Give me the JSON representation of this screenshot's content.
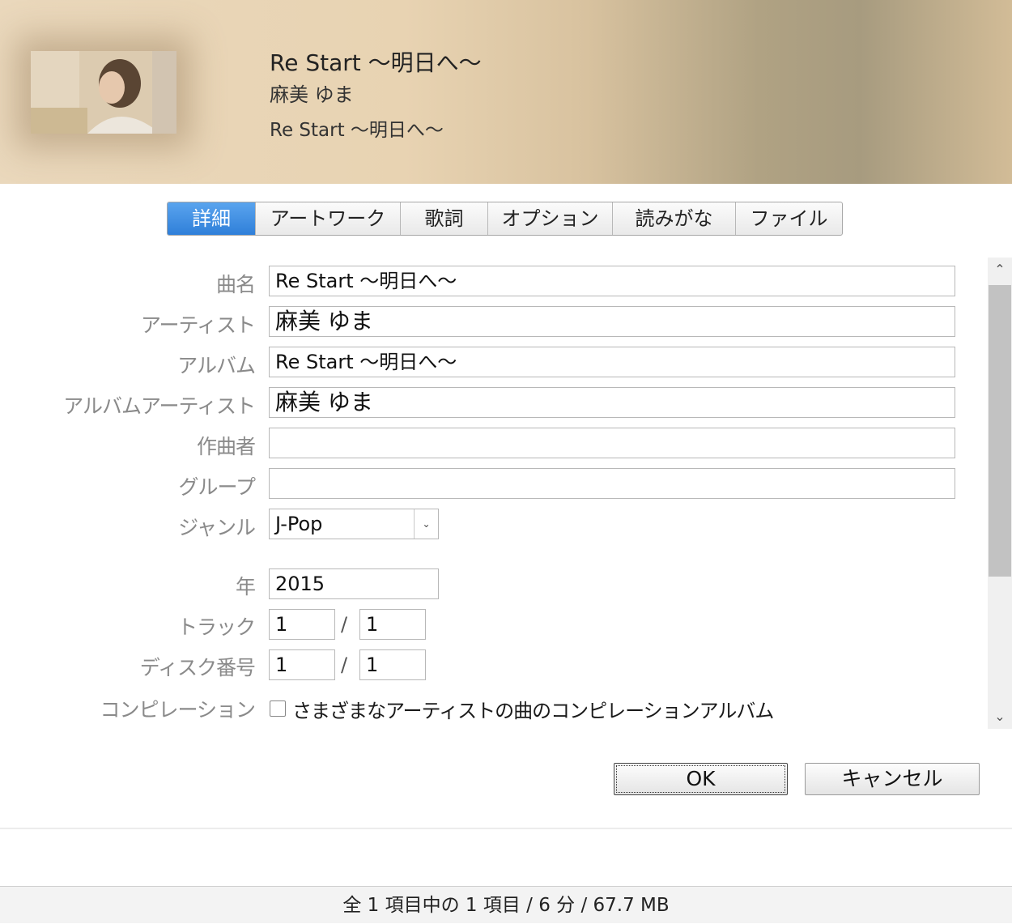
{
  "header": {
    "title": "Re Start 〜明日へ〜",
    "artist": "麻美 ゆま",
    "album": "Re Start 〜明日へ〜"
  },
  "tabs": [
    {
      "label": "詳細",
      "active": true
    },
    {
      "label": "アートワーク",
      "active": false
    },
    {
      "label": "歌詞",
      "active": false
    },
    {
      "label": "オプション",
      "active": false
    },
    {
      "label": "読みがな",
      "active": false
    },
    {
      "label": "ファイル",
      "active": false
    }
  ],
  "form": {
    "song_name": {
      "label": "曲名",
      "value": "Re Start 〜明日へ〜"
    },
    "artist": {
      "label": "アーティスト",
      "value": "麻美 ゆま"
    },
    "album": {
      "label": "アルバム",
      "value": "Re Start 〜明日へ〜"
    },
    "album_artist": {
      "label": "アルバムアーティスト",
      "value": "麻美 ゆま"
    },
    "composer": {
      "label": "作曲者",
      "value": ""
    },
    "grouping": {
      "label": "グループ",
      "value": ""
    },
    "genre": {
      "label": "ジャンル",
      "value": "J-Pop"
    },
    "year": {
      "label": "年",
      "value": "2015"
    },
    "track": {
      "label": "トラック",
      "number": "1",
      "total": "1",
      "separator": "/"
    },
    "disc": {
      "label": "ディスク番号",
      "number": "1",
      "total": "1",
      "separator": "/"
    },
    "compilation": {
      "label": "コンピレーション",
      "checkbox_label": "さまざまなアーティストの曲のコンピレーションアルバム",
      "checked": false
    }
  },
  "buttons": {
    "ok": "OK",
    "cancel": "キャンセル"
  },
  "status_bar": {
    "text": "全 1 項目中の 1 項目 / 6 分 / 67.7 MB"
  },
  "colors": {
    "active_tab": "#3b8ee0",
    "header_gradient_start": "#ead8bc",
    "header_gradient_mid": "#a79b7f"
  }
}
